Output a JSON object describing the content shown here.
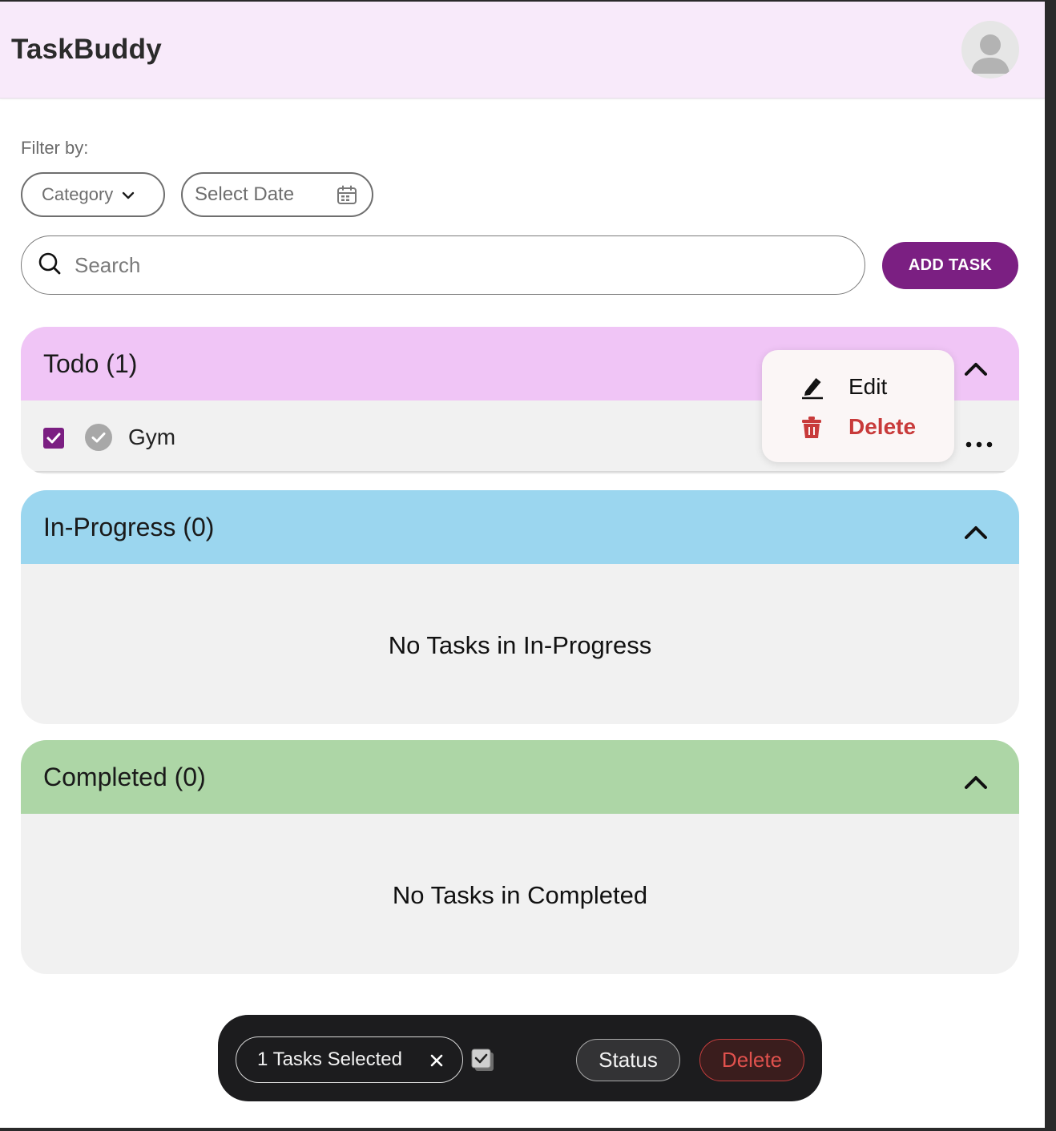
{
  "app": {
    "title": "TaskBuddy"
  },
  "filters": {
    "label": "Filter by:",
    "category_label": "Category",
    "date_label": "Select Date"
  },
  "search": {
    "placeholder": "Search",
    "value": ""
  },
  "actions": {
    "add_task": "ADD TASK"
  },
  "sections": {
    "todo": {
      "title": "Todo (1)",
      "color": "#f0c5f6",
      "tasks": [
        {
          "name": "Gym",
          "selected": true
        }
      ]
    },
    "in_progress": {
      "title": "In-Progress (0)",
      "color": "#9bd6ef",
      "empty_message": "No Tasks in In-Progress"
    },
    "completed": {
      "title": "Completed (0)",
      "color": "#add6a6",
      "empty_message": "No Tasks in Completed"
    }
  },
  "context_menu": {
    "edit_label": "Edit",
    "delete_label": "Delete"
  },
  "bulk_bar": {
    "selected_text": "1 Tasks Selected",
    "status_label": "Status",
    "delete_label": "Delete"
  },
  "colors": {
    "accent": "#7b1f82",
    "danger": "#c83a3a",
    "header_bg": "#f8eafa"
  },
  "icons": {
    "avatar": "user-avatar-icon",
    "category_chevron": "chevron-down-icon",
    "calendar": "calendar-icon",
    "search": "search-icon",
    "collapse": "chevron-up-icon",
    "more": "more-horizontal-icon",
    "edit": "pencil-icon",
    "delete": "trash-icon",
    "close": "close-icon",
    "select_all": "select-all-icon"
  }
}
